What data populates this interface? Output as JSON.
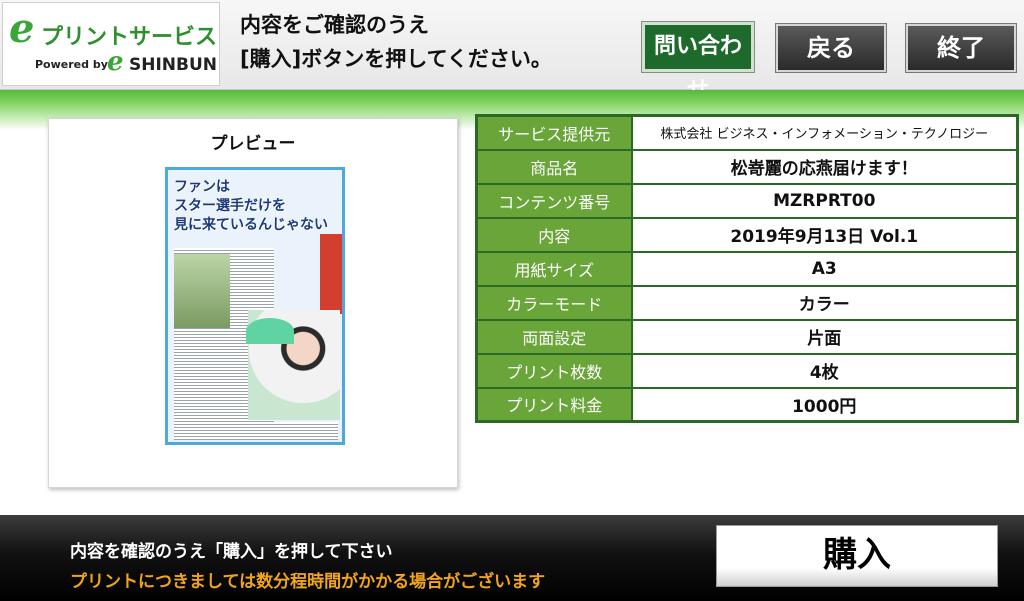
{
  "logo": {
    "mark": "e",
    "title": "プリントサービス",
    "powered_by": "Powered by",
    "brand": "SHINBUN"
  },
  "header": {
    "instruction_line1": "内容をご確認のうえ",
    "instruction_line2": "[購入]ボタンを押してください。",
    "inquiry_label": "問い合わせ",
    "back_label": "戻る",
    "end_label": "終了"
  },
  "preview": {
    "label": "プレビュー",
    "headline_line1": "ファンは",
    "headline_line2": "スター選手だけを",
    "headline_line3": "見に来ているんじゃない"
  },
  "details": {
    "rows": [
      {
        "label": "サービス提供元",
        "value": "株式会社 ビジネス・インフォメーション・テクノロジー"
      },
      {
        "label": "商品名",
        "value": "松嵜麗の応燕届けます！"
      },
      {
        "label": "コンテンツ番号",
        "value": "MZRPRT00"
      },
      {
        "label": "内容",
        "value": "2019年9月13日 Vol.1"
      },
      {
        "label": "用紙サイズ",
        "value": "A3"
      },
      {
        "label": "カラーモード",
        "value": "カラー"
      },
      {
        "label": "両面設定",
        "value": "片面"
      },
      {
        "label": "プリント枚数",
        "value": "4枚"
      },
      {
        "label": "プリント料金",
        "value": "1000円"
      }
    ]
  },
  "footer": {
    "message_line1": "内容を確認のうえ「購入」を押して下さい",
    "message_line2": "プリントにつきましては数分程時間がかかる場合がございます",
    "buy_label": "購入"
  },
  "colors": {
    "brand_green": "#3aa63a",
    "table_label_bg": "#6aa53a",
    "table_border": "#2b6a24",
    "inquiry_bg": "#1e6a2c",
    "footer_warning": "#f2a51a"
  }
}
